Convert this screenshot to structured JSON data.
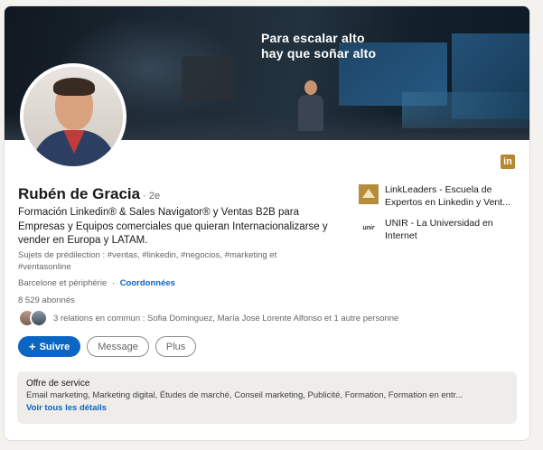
{
  "banner": {
    "slogan_line1": "Para escalar alto",
    "slogan_line2": "hay que soñar alto"
  },
  "profile": {
    "name": "Rubén de Gracia",
    "degree": "· 2e",
    "headline": "Formación Linkedin® & Sales Navigator® y Ventas B2B para Empresas y Equipos comerciales que quieran Internacionalizarse y vender en Europa y LATAM.",
    "topics": "Sujets de prédilection : #ventas, #linkedin, #negocios, #marketing et #ventasonline",
    "location": "Barcelone et périphérie",
    "location_separator": "·",
    "contact_label": "Coordonnées",
    "followers": "8 529 abonnés",
    "mutual_connections": "3 relations en commun : Sofia Dominguez, María José Lorente Alfonso et 1 autre personne",
    "linkedin_badge": "in"
  },
  "actions": {
    "follow_label": "Suivre",
    "follow_icon": "+",
    "message_label": "Message",
    "more_label": "Plus"
  },
  "education": [
    {
      "name": "LinkLeaders - Escuela de Expertos en Linkedin y Vent...",
      "logo_icon": "linkleaders-logo-icon"
    },
    {
      "name": "UNIR - La Universidad en Internet",
      "logo_text": "unir",
      "logo_icon": "unir-logo-icon"
    }
  ],
  "service": {
    "title": "Offre de service",
    "list": "Email marketing, Marketing digital, Études de marché, Conseil marketing, Publicité, Formation, Formation en entr...",
    "link": "Voir tous les détails"
  },
  "colors": {
    "primary": "#0a66c2",
    "linkedin_badge": "#b7862d",
    "service_bg": "#eeedea"
  }
}
